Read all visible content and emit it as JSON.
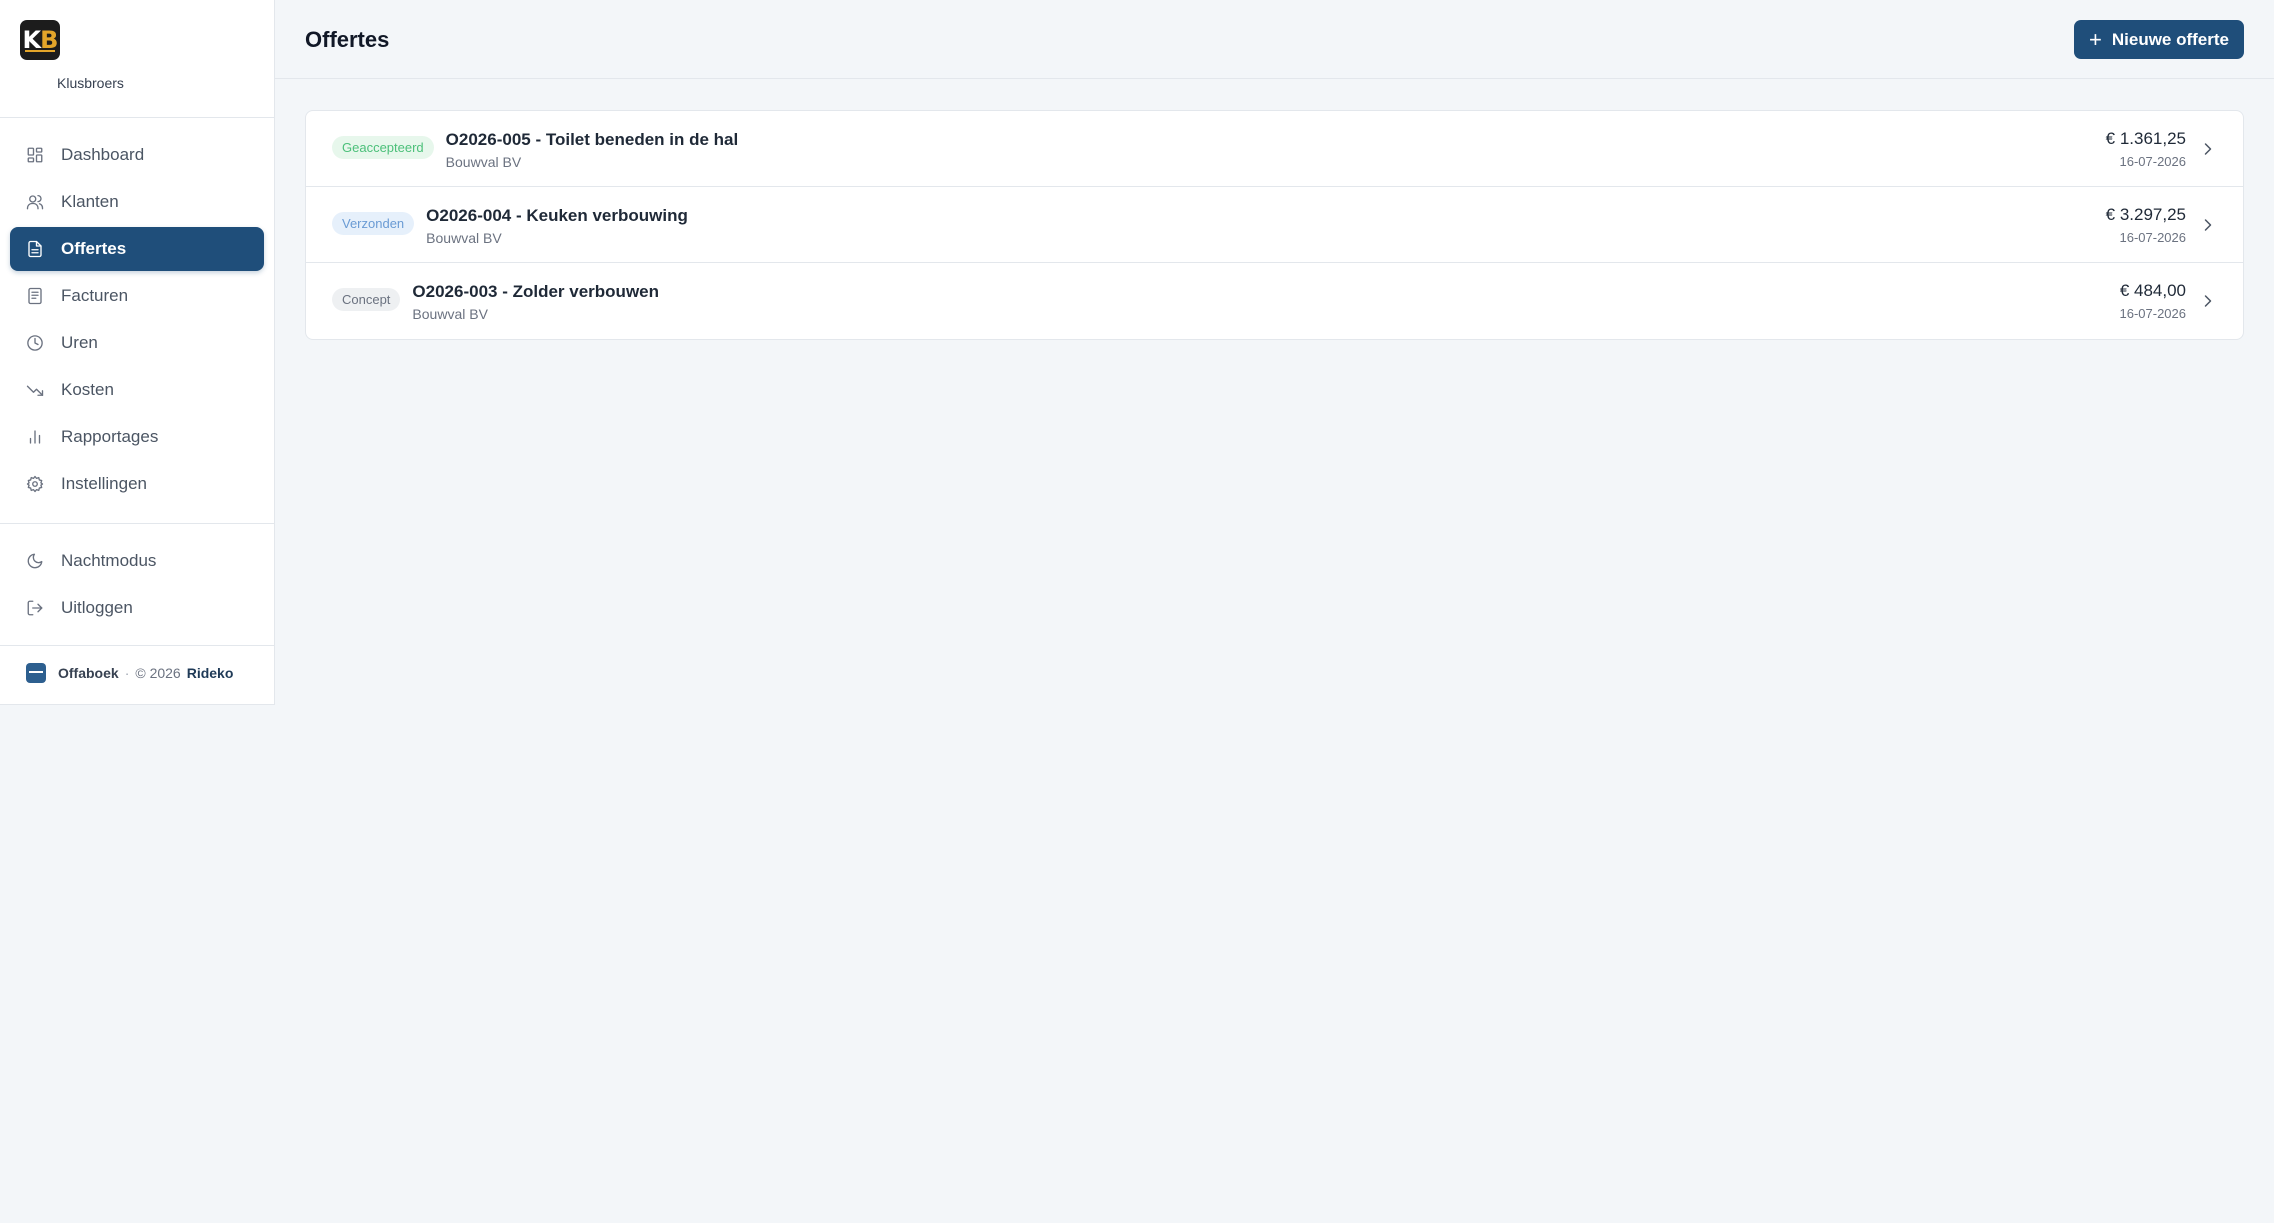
{
  "brand": {
    "logo_k": "K",
    "logo_b": "B",
    "company": "Klusbroers"
  },
  "sidebar": {
    "items": [
      {
        "label": "Dashboard",
        "icon": "dashboard-icon"
      },
      {
        "label": "Klanten",
        "icon": "users-icon"
      },
      {
        "label": "Offertes",
        "icon": "document-icon",
        "active": true
      },
      {
        "label": "Facturen",
        "icon": "invoice-icon"
      },
      {
        "label": "Uren",
        "icon": "clock-icon"
      },
      {
        "label": "Kosten",
        "icon": "trending-down-icon"
      },
      {
        "label": "Rapportages",
        "icon": "bar-chart-icon"
      },
      {
        "label": "Instellingen",
        "icon": "gear-icon"
      }
    ],
    "secondary": [
      {
        "label": "Nachtmodus",
        "icon": "moon-icon"
      },
      {
        "label": "Uitloggen",
        "icon": "logout-icon"
      }
    ],
    "footer": {
      "brand": "Offaboek",
      "separator": "·",
      "copyright": "© 2026",
      "company": "Rideko"
    }
  },
  "header": {
    "title": "Offertes",
    "new_button_label": "Nieuwe offerte",
    "new_button_icon": "plus-icon"
  },
  "quotes": [
    {
      "status": "Geaccepteerd",
      "status_color": "#4cc07a",
      "title": "O2026-005 - Toilet beneden in de hal",
      "client": "Bouwval BV",
      "amount": "€ 1.361,25",
      "date": "16-07-2026"
    },
    {
      "status": "Verzonden",
      "status_color": "#6a9bd4",
      "title": "O2026-004 - Keuken verbouwing",
      "client": "Bouwval BV",
      "amount": "€ 3.297,25",
      "date": "16-07-2026"
    },
    {
      "status": "Concept",
      "status_color": "#6b7280",
      "title": "O2026-003 - Zolder verbouwen",
      "client": "Bouwval BV",
      "amount": "€ 484,00",
      "date": "16-07-2026"
    }
  ],
  "colors": {
    "accent": "#1f4e7a",
    "background": "#f3f6f9"
  }
}
